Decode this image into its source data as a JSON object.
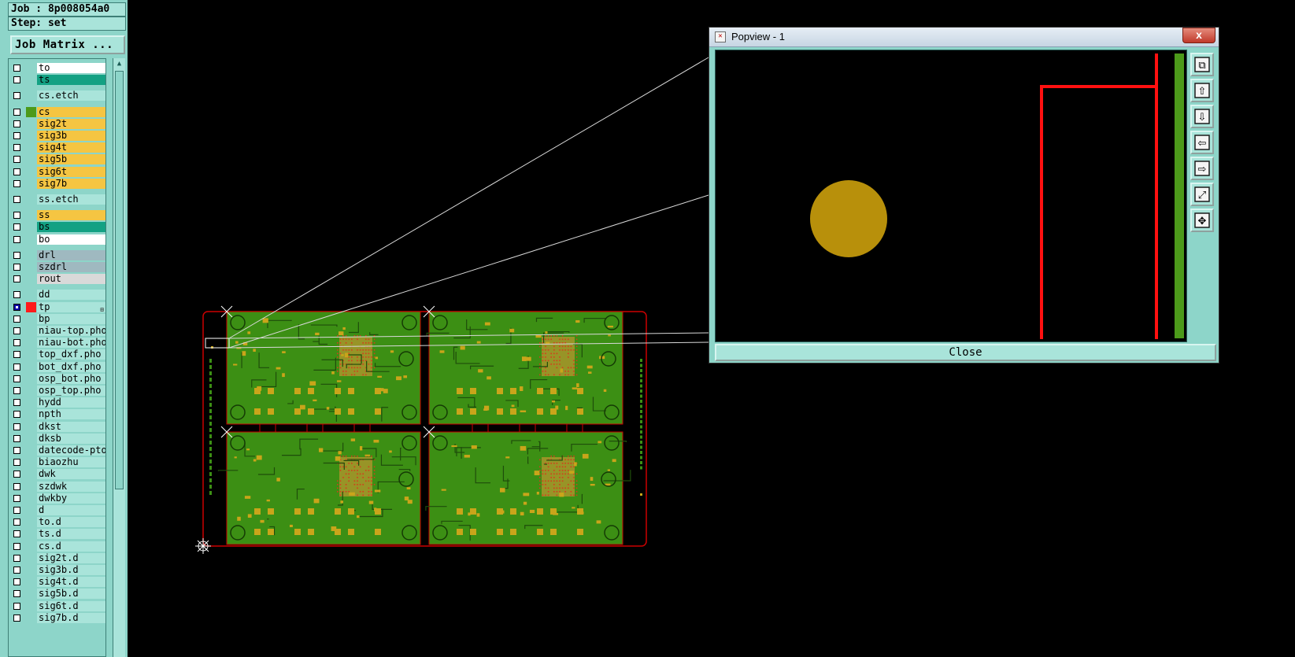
{
  "sidebar": {
    "job_label": "Job : 8p008054a0",
    "step_label": "Step: set",
    "job_matrix_button": "Job Matrix ...",
    "layers": [
      {
        "name": "to",
        "color": "#ffffff",
        "swatch": "",
        "group": 0
      },
      {
        "name": "ts",
        "color": "#13a183",
        "swatch": "",
        "group": 0
      },
      {
        "name": "cs.etch",
        "color": "#a9e4da",
        "swatch": "",
        "group": 1
      },
      {
        "name": "cs",
        "color": "#f5c542",
        "swatch": "#4c9a1a",
        "group": 2
      },
      {
        "name": "sig2t",
        "color": "#f5c542",
        "swatch": "",
        "group": 2
      },
      {
        "name": "sig3b",
        "color": "#f5c542",
        "swatch": "",
        "group": 2
      },
      {
        "name": "sig4t",
        "color": "#f5c542",
        "swatch": "",
        "group": 2
      },
      {
        "name": "sig5b",
        "color": "#f5c542",
        "swatch": "",
        "group": 2
      },
      {
        "name": "sig6t",
        "color": "#f5c542",
        "swatch": "",
        "group": 2
      },
      {
        "name": "sig7b",
        "color": "#f5c542",
        "swatch": "",
        "group": 2
      },
      {
        "name": "ss.etch",
        "color": "#a9e4da",
        "swatch": "",
        "group": 3
      },
      {
        "name": "ss",
        "color": "#f5c542",
        "swatch": "",
        "group": 4
      },
      {
        "name": "bs",
        "color": "#13a183",
        "swatch": "",
        "group": 4
      },
      {
        "name": "bo",
        "color": "#ffffff",
        "swatch": "",
        "group": 4
      },
      {
        "name": "drl",
        "color": "#9fb9c0",
        "swatch": "",
        "group": 5
      },
      {
        "name": "szdrl",
        "color": "#9fb9c0",
        "swatch": "",
        "group": 5
      },
      {
        "name": "rout",
        "color": "#d9d9d9",
        "swatch": "",
        "group": 5
      },
      {
        "name": "dd",
        "color": "#a9e4da",
        "swatch": "",
        "group": 6
      },
      {
        "name": "tp",
        "color": "#a9e4da",
        "swatch": "#ff1a1a",
        "group": 6,
        "active": true
      },
      {
        "name": "bp",
        "color": "#a9e4da",
        "swatch": "",
        "group": 6
      },
      {
        "name": "niau-top.pho",
        "color": "#a9e4da",
        "swatch": "",
        "group": 6
      },
      {
        "name": "niau-bot.pho",
        "color": "#a9e4da",
        "swatch": "",
        "group": 6
      },
      {
        "name": "top_dxf.pho",
        "color": "#a9e4da",
        "swatch": "",
        "group": 6
      },
      {
        "name": "bot_dxf.pho",
        "color": "#a9e4da",
        "swatch": "",
        "group": 6
      },
      {
        "name": "osp_bot.pho",
        "color": "#a9e4da",
        "swatch": "",
        "group": 6
      },
      {
        "name": "osp_top.pho",
        "color": "#a9e4da",
        "swatch": "",
        "group": 6
      },
      {
        "name": "hydd",
        "color": "#a9e4da",
        "swatch": "",
        "group": 6
      },
      {
        "name": "npth",
        "color": "#a9e4da",
        "swatch": "",
        "group": 6
      },
      {
        "name": "dkst",
        "color": "#a9e4da",
        "swatch": "",
        "group": 6
      },
      {
        "name": "dksb",
        "color": "#a9e4da",
        "swatch": "",
        "group": 6
      },
      {
        "name": "datecode-pto",
        "color": "#a9e4da",
        "swatch": "",
        "group": 6
      },
      {
        "name": "biaozhu",
        "color": "#a9e4da",
        "swatch": "",
        "group": 6
      },
      {
        "name": "dwk",
        "color": "#a9e4da",
        "swatch": "",
        "group": 6
      },
      {
        "name": "szdwk",
        "color": "#a9e4da",
        "swatch": "",
        "group": 6
      },
      {
        "name": "dwkby",
        "color": "#a9e4da",
        "swatch": "",
        "group": 6
      },
      {
        "name": "d",
        "color": "#a9e4da",
        "swatch": "",
        "group": 6
      },
      {
        "name": "to.d",
        "color": "#a9e4da",
        "swatch": "",
        "group": 6
      },
      {
        "name": "ts.d",
        "color": "#a9e4da",
        "swatch": "",
        "group": 6
      },
      {
        "name": "cs.d",
        "color": "#a9e4da",
        "swatch": "",
        "group": 6
      },
      {
        "name": "sig2t.d",
        "color": "#a9e4da",
        "swatch": "",
        "group": 6
      },
      {
        "name": "sig3b.d",
        "color": "#a9e4da",
        "swatch": "",
        "group": 6
      },
      {
        "name": "sig4t.d",
        "color": "#a9e4da",
        "swatch": "",
        "group": 6
      },
      {
        "name": "sig5b.d",
        "color": "#a9e4da",
        "swatch": "",
        "group": 6
      },
      {
        "name": "sig6t.d",
        "color": "#a9e4da",
        "swatch": "",
        "group": 6
      },
      {
        "name": "sig7b.d",
        "color": "#a9e4da",
        "swatch": "",
        "group": 6
      }
    ]
  },
  "canvas": {
    "board_color": "#3c8f14",
    "profile_color": "#cc0000"
  },
  "popview": {
    "title": "Popview - 1",
    "close_x": "x",
    "close_button": "Close",
    "pad_color": "#b8900b",
    "trace_color": "#ff1010",
    "strip_color": "#4c9a1a",
    "tools": [
      "zoom-window-icon",
      "pan-up-icon",
      "pan-down-icon",
      "pan-left-icon",
      "pan-right-icon",
      "zoom-fit-icon",
      "zoom-home-icon"
    ]
  }
}
